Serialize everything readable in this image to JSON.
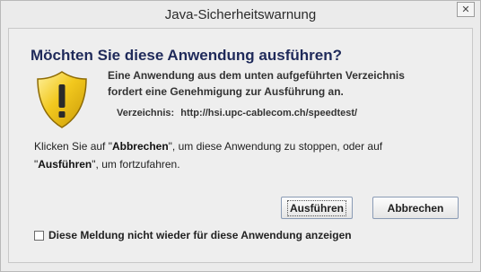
{
  "window": {
    "title": "Java-Sicherheitswarnung",
    "close_symbol": "✕"
  },
  "dialog": {
    "heading": "Möchten Sie diese Anwendung ausführen?",
    "icon": "warning-shield-icon",
    "description_line1": "Eine Anwendung aus dem unten aufgeführten Verzeichnis",
    "description_line2": "fordert eine Genehmigung zur Ausführung an.",
    "location_label": "Verzeichnis:",
    "location_value": "http://hsi.upc-cablecom.ch/speedtest/",
    "instructions": {
      "part1": "Klicken Sie auf \"",
      "cancel_word": "Abbrechen",
      "part2": "\", um diese Anwendung zu stoppen, oder auf",
      "part3": "\"",
      "run_word": "Ausführen",
      "part4": "\", um fortzufahren."
    },
    "buttons": {
      "run": "Ausführen",
      "cancel": "Abbrechen"
    },
    "checkbox": {
      "label": "Diese Meldung nicht wieder für diese Anwendung anzeigen",
      "checked": false
    }
  },
  "colors": {
    "heading": "#1f2a5a",
    "shield_fill": "#f2c81e"
  }
}
